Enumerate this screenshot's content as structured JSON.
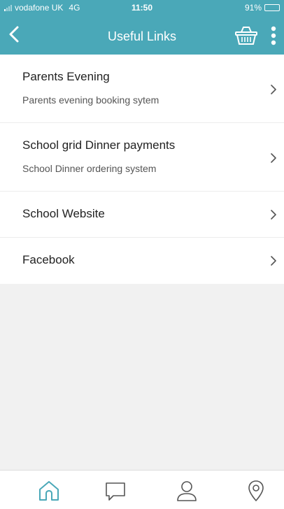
{
  "status_bar": {
    "carrier": "vodafone UK",
    "network": "4G",
    "time": "11:50",
    "battery": "91%",
    "battery_level": 0.91
  },
  "header": {
    "title": "Useful Links",
    "back_icon": "chevron-left-icon",
    "basket_icon": "basket-icon",
    "more_icon": "more-vertical-icon"
  },
  "links": [
    {
      "title": "Parents Evening",
      "subtitle": "Parents evening booking sytem"
    },
    {
      "title": "School grid Dinner payments",
      "subtitle": "School Dinner ordering system"
    },
    {
      "title": "School Website"
    },
    {
      "title": "Facebook"
    }
  ],
  "tabbar": {
    "items": [
      {
        "icon": "home-icon"
      },
      {
        "icon": "chat-icon"
      },
      {
        "icon": "profile-icon"
      },
      {
        "icon": "location-pin-icon"
      }
    ]
  },
  "colors": {
    "header_bg": "#4aa8b8",
    "accent": "#4aa8b8",
    "background": "#f1f1f1"
  }
}
